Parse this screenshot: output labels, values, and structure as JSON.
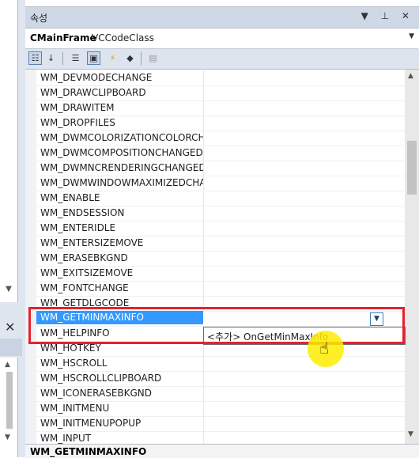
{
  "panel": {
    "title": "속성",
    "title_icons": "▼ ⊥ ✕"
  },
  "object": {
    "name": "CMainFrame",
    "type": "VCCodeClass"
  },
  "toolbar": {
    "buttons": [
      "categorized-icon",
      "alphabetical-icon",
      "properties-icon",
      "events-icon",
      "messages-icon",
      "overrides-icon",
      "property-pages-icon"
    ]
  },
  "grid": {
    "rows": [
      "WM_DEVMODECHANGE",
      "WM_DRAWCLIPBOARD",
      "WM_DRAWITEM",
      "WM_DROPFILES",
      "WM_DWMCOLORIZATIONCOLORCHA",
      "WM_DWMCOMPOSITIONCHANGED",
      "WM_DWMNCRENDERINGCHANGED",
      "WM_DWMWINDOWMAXIMIZEDCHAN",
      "WM_ENABLE",
      "WM_ENDSESSION",
      "WM_ENTERIDLE",
      "WM_ENTERSIZEMOVE",
      "WM_ERASEBKGND",
      "WM_EXITSIZEMOVE",
      "WM_FONTCHANGE",
      "WM_GETDLGCODE",
      "WM_GETMINMAXINFO",
      "WM_HELPINFO",
      "WM_HOTKEY",
      "WM_HSCROLL",
      "WM_HSCROLLCLIPBOARD",
      "WM_ICONERASEBKGND",
      "WM_INITMENU",
      "WM_INITMENUPOPUP",
      "WM_INPUT"
    ],
    "selected_index": 16
  },
  "dropdown": {
    "item": "<추가> OnGetMinMaxInfo"
  },
  "status": {
    "text": "WM_GETMINMAXINFO"
  }
}
